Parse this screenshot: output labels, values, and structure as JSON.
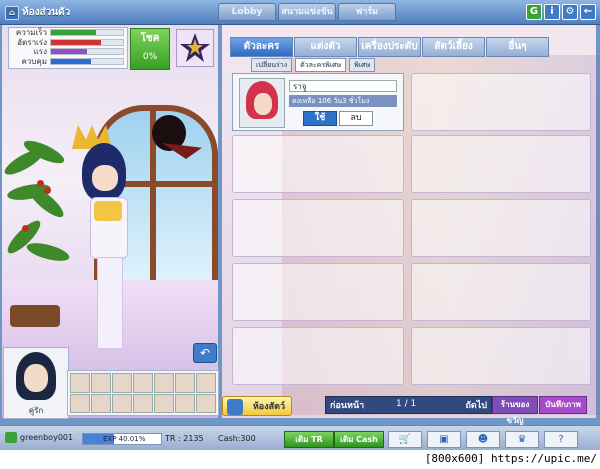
{
  "window": {
    "title": "ห้องส่วนตัว"
  },
  "top_tabs": [
    "Lobby",
    "สนามแข่งขัน",
    "ฟาร์ม"
  ],
  "window_buttons": [
    "G",
    "i",
    "⚙",
    "←"
  ],
  "stats": {
    "rows": [
      {
        "label": "ความเร็ว",
        "value": 0.62,
        "color": "#35a23a"
      },
      {
        "label": "อัตราเร่ง",
        "value": 0.7,
        "color": "#cc3333"
      },
      {
        "label": "แรง",
        "value": 0.5,
        "color": "#9a4bc2"
      },
      {
        "label": "ควบคุม",
        "value": 0.55,
        "color": "#2c6bd0"
      }
    ],
    "level_label": "โชค",
    "level_value": "0%"
  },
  "main_tabs": [
    {
      "label": "ตัวละคร",
      "active": true
    },
    {
      "label": "แต่งตัว",
      "active": false
    },
    {
      "label": "เครื่องประดับ",
      "active": false
    },
    {
      "label": "สัตว์เลี้ยง",
      "active": false
    },
    {
      "label": "อื่นๆ",
      "active": false
    }
  ],
  "sub_tabs": [
    {
      "label": "เปลี่ยนร่าง",
      "active": false
    },
    {
      "label": "ตัวละครพิเศษ",
      "active": true
    },
    {
      "label": "พิเศษ",
      "active": false
    }
  ],
  "selected_item": {
    "name": "ราจู",
    "desc": "คงเหลือ 106 วัน3 ชั่วโมง",
    "use_label": "ใช้",
    "delete_label": "ลบ"
  },
  "pager": {
    "prev": "ก่อนหน้า",
    "page": "1 / 1",
    "next": "ถัดไป"
  },
  "shop_button": "ร้านของขวัญ",
  "save_button": "บันทึกภาพ",
  "wardrobe_button": "ห้องสัตว์",
  "portrait_name": "คู่รัก",
  "status": {
    "username": "greenboy001",
    "exp_text": "EXP 40.01%",
    "exp_value": 0.4,
    "tr_text": "TR : 2135",
    "cash_text": "Cash:300",
    "topup_tr": "เติม TR",
    "topup_cash": "เติม Cash"
  },
  "nav_icons": [
    "cart-icon",
    "bag-icon",
    "people-icon",
    "trophy-icon",
    "help-icon"
  ],
  "watermark": "[800x600] https://upic.me/"
}
